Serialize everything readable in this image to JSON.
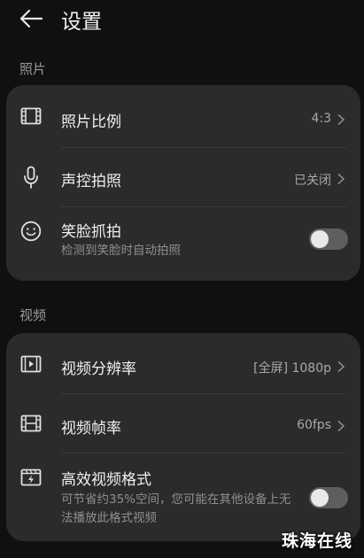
{
  "header": {
    "title": "设置"
  },
  "photo_section": {
    "label": "照片",
    "aspect_ratio": {
      "title": "照片比例",
      "value": "4:3"
    },
    "voice_capture": {
      "title": "声控拍照",
      "value": "已关闭"
    },
    "smile_capture": {
      "title": "笑脸抓拍",
      "subtitle": "检测到笑脸时自动拍照",
      "enabled": false
    }
  },
  "video_section": {
    "label": "视频",
    "resolution": {
      "title": "视频分辨率",
      "value": "[全屏] 1080p"
    },
    "frame_rate": {
      "title": "视频帧率",
      "value": "60fps"
    },
    "efficient_format": {
      "title": "高效视频格式",
      "subtitle": "可节省约35%空间，您可能在其他设备上无法播放此格式视频",
      "enabled": false
    }
  },
  "watermark": "珠海在线",
  "colors": {
    "background": "#101010",
    "card": "#2b2b2b",
    "toggle_off": "#5e5e5e"
  },
  "icons": [
    "back-arrow-icon",
    "aspect-ratio-icon",
    "microphone-icon",
    "smiley-icon",
    "video-resolution-icon",
    "film-strip-icon",
    "efficient-video-icon",
    "chevron-right-icon"
  ]
}
